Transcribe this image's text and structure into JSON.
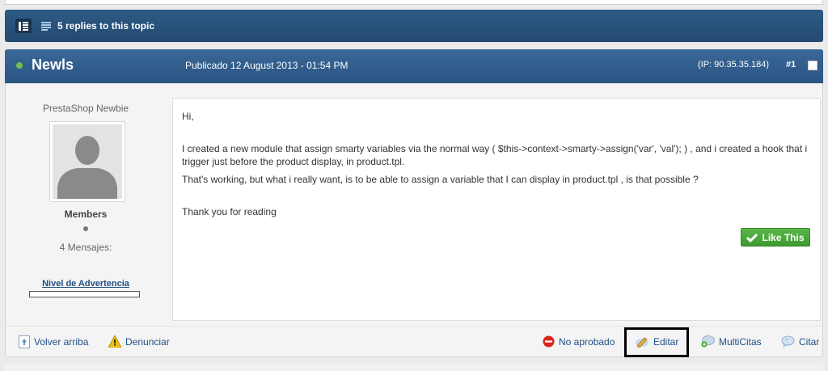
{
  "topic_bar": {
    "replies_label": "5 replies to this topic"
  },
  "post": {
    "author": "Newls",
    "published": "Publicado 12 August 2013 - 01:54 PM",
    "ip": "(IP: 90.35.35.184)",
    "number": "#1",
    "author_group_title": "PrestaShop Newbie",
    "author_rank": "Members",
    "author_posts": "4 Mensajes:",
    "warning_label": "Nivel de Advertencia",
    "body": {
      "greeting": "Hi,",
      "line1": "I created a new module that assign smarty variables via the normal way ( $this->context->smarty->assign('var', 'val'); ) , and i created a hook that i trigger just before the product display, in product.tpl.",
      "line2": "That's working, but what i really want, is to be able to assign a variable that I can display in product.tpl , is that possible ?",
      "closing": "Thank you for reading"
    },
    "like_label": "Like This"
  },
  "footer": {
    "back_to_top": "Volver arriba",
    "report": "Denunciar",
    "not_approved": "No aprobado",
    "edit": "Editar",
    "multiquote": "MultiCitas",
    "quote": "Citar"
  },
  "colors": {
    "header_blue": "#2a5482",
    "online_green": "#6ec04a",
    "like_green": "#3d9a2e",
    "link_blue": "#1f4f84"
  }
}
